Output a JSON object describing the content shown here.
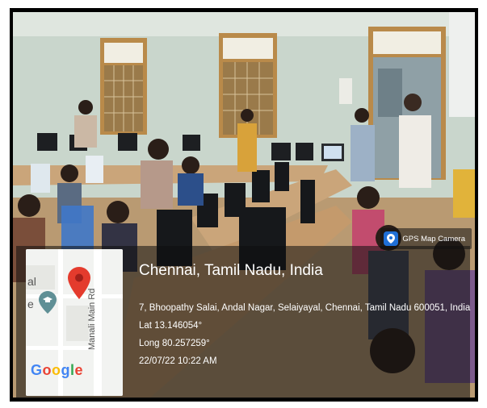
{
  "gps_app": {
    "name": "GPS Map Camera",
    "icon": "map-pin-icon"
  },
  "location": {
    "title": "Chennai, Tamil Nadu, India",
    "address": "7, Bhoopathy Salai, Andal Nagar, Selaiyayal, Chennai, Tamil Nadu 600051, India",
    "latitude": "Lat 13.146054°",
    "longitude": "Long 80.257259°",
    "datetime": "22/07/22 10:22 AM"
  },
  "map": {
    "road_name": "Manali Main Rd",
    "edge_text_top": "al",
    "edge_text_mid": "e",
    "provider": "Google",
    "marker_icon": "map-pin-icon",
    "poi_icon": "graduation-cap-icon"
  },
  "colors": {
    "wall": "#c9d6cc",
    "floor": "#b99a72",
    "desk": "#caa57a",
    "window_frame": "#b98a4a",
    "marker": "#e43b2d"
  }
}
